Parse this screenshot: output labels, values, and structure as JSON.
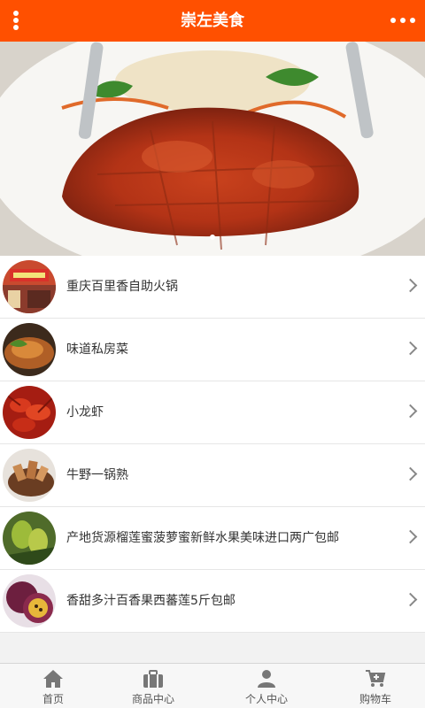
{
  "header": {
    "title": "崇左美食",
    "menu_icon": "vertical-dots-menu-icon",
    "more_icon": "horizontal-dots-more-icon",
    "bg_color": "#ff5000"
  },
  "banner": {
    "image": "roast-duck-plate-photo",
    "dots_total": 1,
    "dots_active": 1
  },
  "list": {
    "items": [
      {
        "label": "重庆百里香自助火锅",
        "icon": "hotpot-restaurant-thumbnail"
      },
      {
        "label": "味道私房菜",
        "icon": "home-cooking-dish-thumbnail"
      },
      {
        "label": "小龙虾",
        "icon": "crayfish-thumbnail"
      },
      {
        "label": "牛野一锅熟",
        "icon": "beef-pot-thumbnail"
      },
      {
        "label": "产地货源榴莲蜜菠萝蜜新鲜水果美味进口两广包邮",
        "icon": "jackfruit-thumbnail"
      },
      {
        "label": "香甜多汁百香果西蕃莲5斤包邮",
        "icon": "passion-fruit-thumbnail"
      }
    ]
  },
  "footer": {
    "tabs": [
      {
        "label": "首页",
        "icon": "home-icon"
      },
      {
        "label": "商品中心",
        "icon": "briefcase-icon"
      },
      {
        "label": "个人中心",
        "icon": "user-icon"
      },
      {
        "label": "购物车",
        "icon": "cart-icon"
      }
    ]
  }
}
